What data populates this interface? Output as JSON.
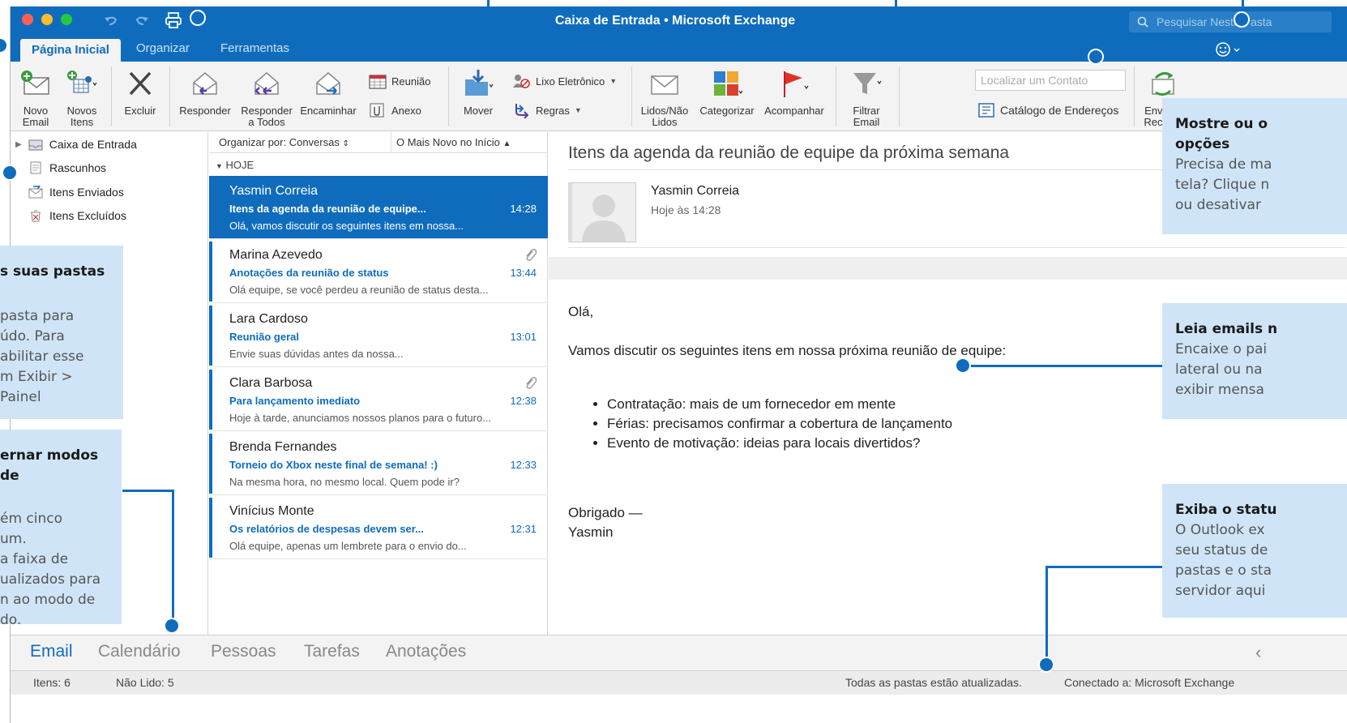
{
  "window": {
    "title": "Caixa de Entrada • Microsoft Exchange",
    "search_placeholder": "Pesquisar Nesta Pasta"
  },
  "tabs": [
    "Página Inicial",
    "Organizar",
    "Ferramentas"
  ],
  "ribbon": {
    "novo_email": [
      "Novo",
      "Email"
    ],
    "novos_itens": [
      "Novos",
      "Itens"
    ],
    "excluir": "Excluir",
    "responder": "Responder",
    "responder_todos": [
      "Responder",
      "a Todos"
    ],
    "encaminhar": "Encaminhar",
    "reuniao": "Reunião",
    "anexo": "Anexo",
    "mover": "Mover",
    "lixo": "Lixo Eletrônico",
    "regras": "Regras",
    "lidos": [
      "Lidos/Não",
      "Lidos"
    ],
    "categorizar": "Categorizar",
    "acompanhar": "Acompanhar",
    "filtrar": [
      "Filtrar",
      "Email"
    ],
    "contato_placeholder": "Localizar um Contato",
    "catalogo": "Catálogo de Endereços",
    "enviar": [
      "Enviar e",
      "Receber"
    ]
  },
  "folders": [
    "Caixa de Entrada",
    "Rascunhos",
    "Itens Enviados",
    "Itens Excluídos"
  ],
  "list": {
    "sort": "Organizar por: Conversas",
    "order": "O Mais Novo no Início",
    "group": "HOJE",
    "messages": [
      {
        "from": "Yasmin Correia",
        "subject": "Itens da agenda da reunião de equipe...",
        "time": "14:28",
        "preview": "Olá, vamos discutir os seguintes itens em nossa..."
      },
      {
        "from": "Marina Azevedo",
        "subject": "Anotações da reunião de status",
        "time": "13:44",
        "preview": "Olá equipe, se você perdeu a reunião de status desta..."
      },
      {
        "from": "Lara Cardoso",
        "subject": "Reunião geral",
        "time": "13:01",
        "preview": "Envie suas dúvidas antes da nossa..."
      },
      {
        "from": "Clara Barbosa",
        "subject": "Para lançamento imediato",
        "time": "12:38",
        "preview": "Hoje à tarde, anunciamos nossos planos para o futuro..."
      },
      {
        "from": "Brenda Fernandes",
        "subject": "Torneio do Xbox neste final de semana! :)",
        "time": "12:33",
        "preview": "Na mesma hora, no mesmo local. Quem pode ir?"
      },
      {
        "from": "Vinícius Monte",
        "subject": "Os relatórios de despesas devem ser...",
        "time": "12:31",
        "preview": "Olá equipe, apenas um lembrete para o envio do..."
      }
    ]
  },
  "reading": {
    "subject": "Itens da agenda da reunião de equipe da próxima semana",
    "sender": "Yasmin Correia",
    "date": "Hoje às 14:28",
    "greeting": "Olá,",
    "intro": "Vamos discutir os seguintes itens em nossa próxima reunião de equipe:",
    "bullets": [
      "Contratação: mais de um fornecedor em mente",
      "Férias: precisamos confirmar a cobertura de lançamento",
      "Evento de motivação: ideias para locais divertidos?"
    ],
    "sign1": "Obrigado —",
    "sign2": "Yasmin"
  },
  "nav": [
    "Email",
    "Calendário",
    "Pessoas",
    "Tarefas",
    "Anotações"
  ],
  "status": {
    "itens": "Itens: 6",
    "naolido": "Não Lido: 5",
    "sync": "Todas as pastas estão atualizadas.",
    "conn": "Conectado a: Microsoft Exchange"
  },
  "callouts": {
    "pastas": {
      "h": "s suas pastas",
      "lines": [
        "pasta para",
        "údo. Para",
        "abilitar esse",
        "m Exibir > Painel"
      ]
    },
    "modos": {
      "h": "ernar modos de",
      "lines": [
        "ém cinco",
        "um.",
        "a faixa de",
        "ualizados para",
        "n ao modo de",
        "do."
      ]
    },
    "mostre": {
      "h1": "Mostre ou o",
      "h2": "opções",
      "lines": [
        "Precisa de ma",
        "tela? Clique n",
        "ou desativar"
      ]
    },
    "leia": {
      "h": "Leia emails n",
      "lines": [
        "Encaixe o pai",
        "lateral ou na",
        "exibir mensa"
      ]
    },
    "exiba": {
      "h": "Exiba o statu",
      "lines": [
        "O Outlook ex",
        "seu status de",
        "pastas e o sta",
        "servidor aqui"
      ]
    }
  },
  "colors": {
    "accent": "#0f6cbd",
    "callout": "#cfe5f7"
  }
}
